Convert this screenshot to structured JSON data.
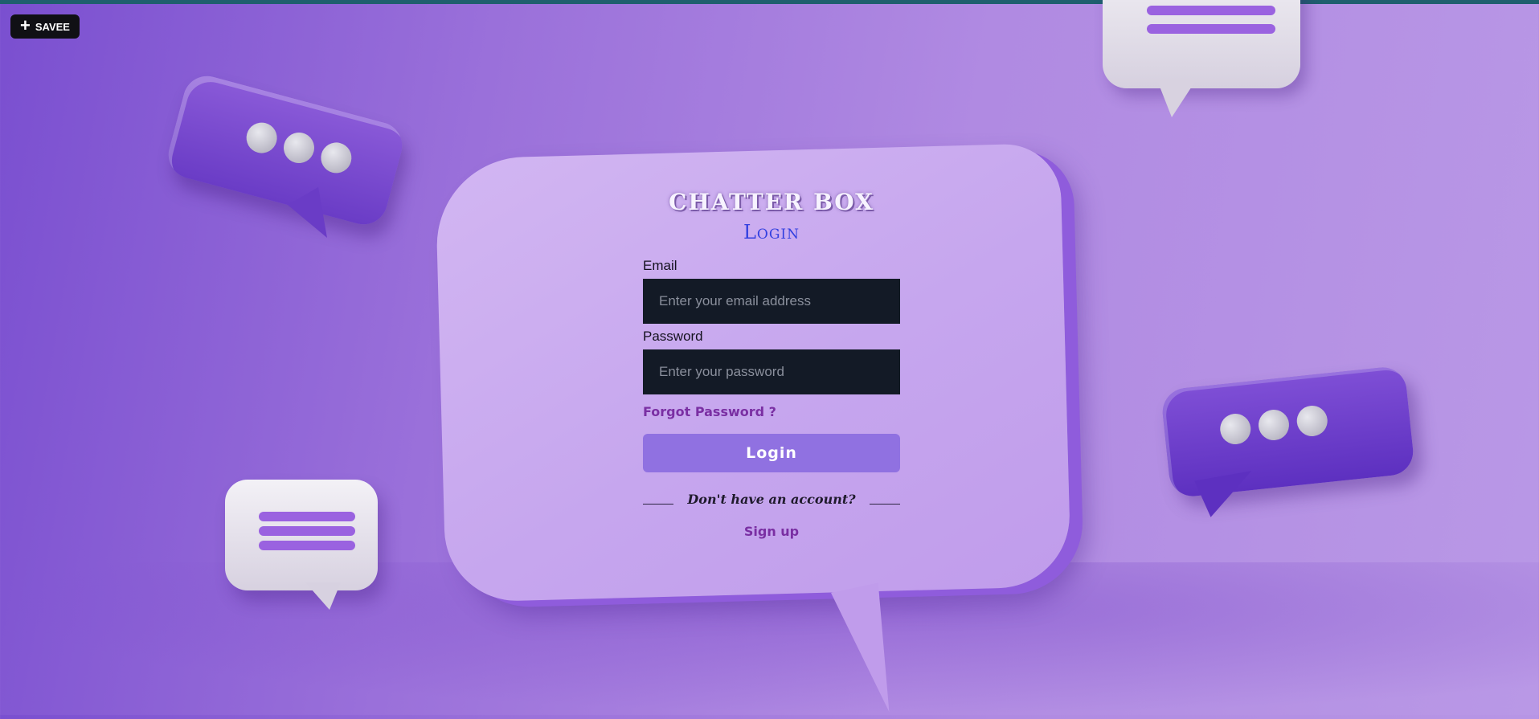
{
  "toolbar": {
    "savee_label": "SAVEE",
    "savee_icon": "plus-icon"
  },
  "app": {
    "title": "CHATTER BOX",
    "heading": "Login"
  },
  "form": {
    "email_label": "Email",
    "email_placeholder": "Enter your email address",
    "email_value": "",
    "password_label": "Password",
    "password_placeholder": "Enter your password",
    "password_value": "",
    "forgot_password": "Forgot Password ?",
    "login_button": "Login",
    "no_account": "Don't have an account?",
    "signup_link": "Sign up"
  },
  "colors": {
    "accent": "#9071e1",
    "link": "#7a2fa3",
    "input_bg": "#131a26",
    "heading": "#3340e0"
  }
}
